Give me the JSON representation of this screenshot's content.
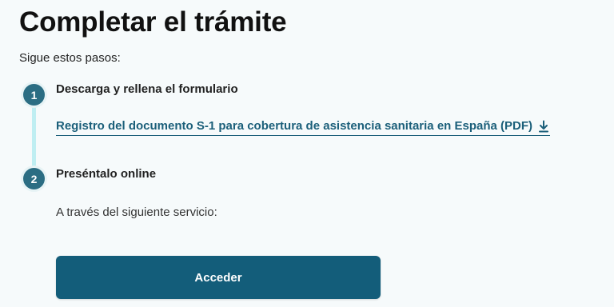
{
  "page": {
    "title": "Completar el trámite",
    "intro": "Sigue estos pasos:"
  },
  "steps": [
    {
      "number": "1",
      "title": "Descarga y rellena el formulario",
      "link_label": "Registro del documento S-1 para cobertura de asistencia sanitaria en España (PDF)",
      "link_icon": "download-icon"
    },
    {
      "number": "2",
      "title": "Preséntalo online",
      "description": "A través del siguiente servicio:",
      "button_label": "Acceder"
    }
  ],
  "colors": {
    "accent": "#135d7a",
    "badge": "#2b6d83",
    "timeline": "#bfeef2",
    "background": "#f6fafb"
  }
}
